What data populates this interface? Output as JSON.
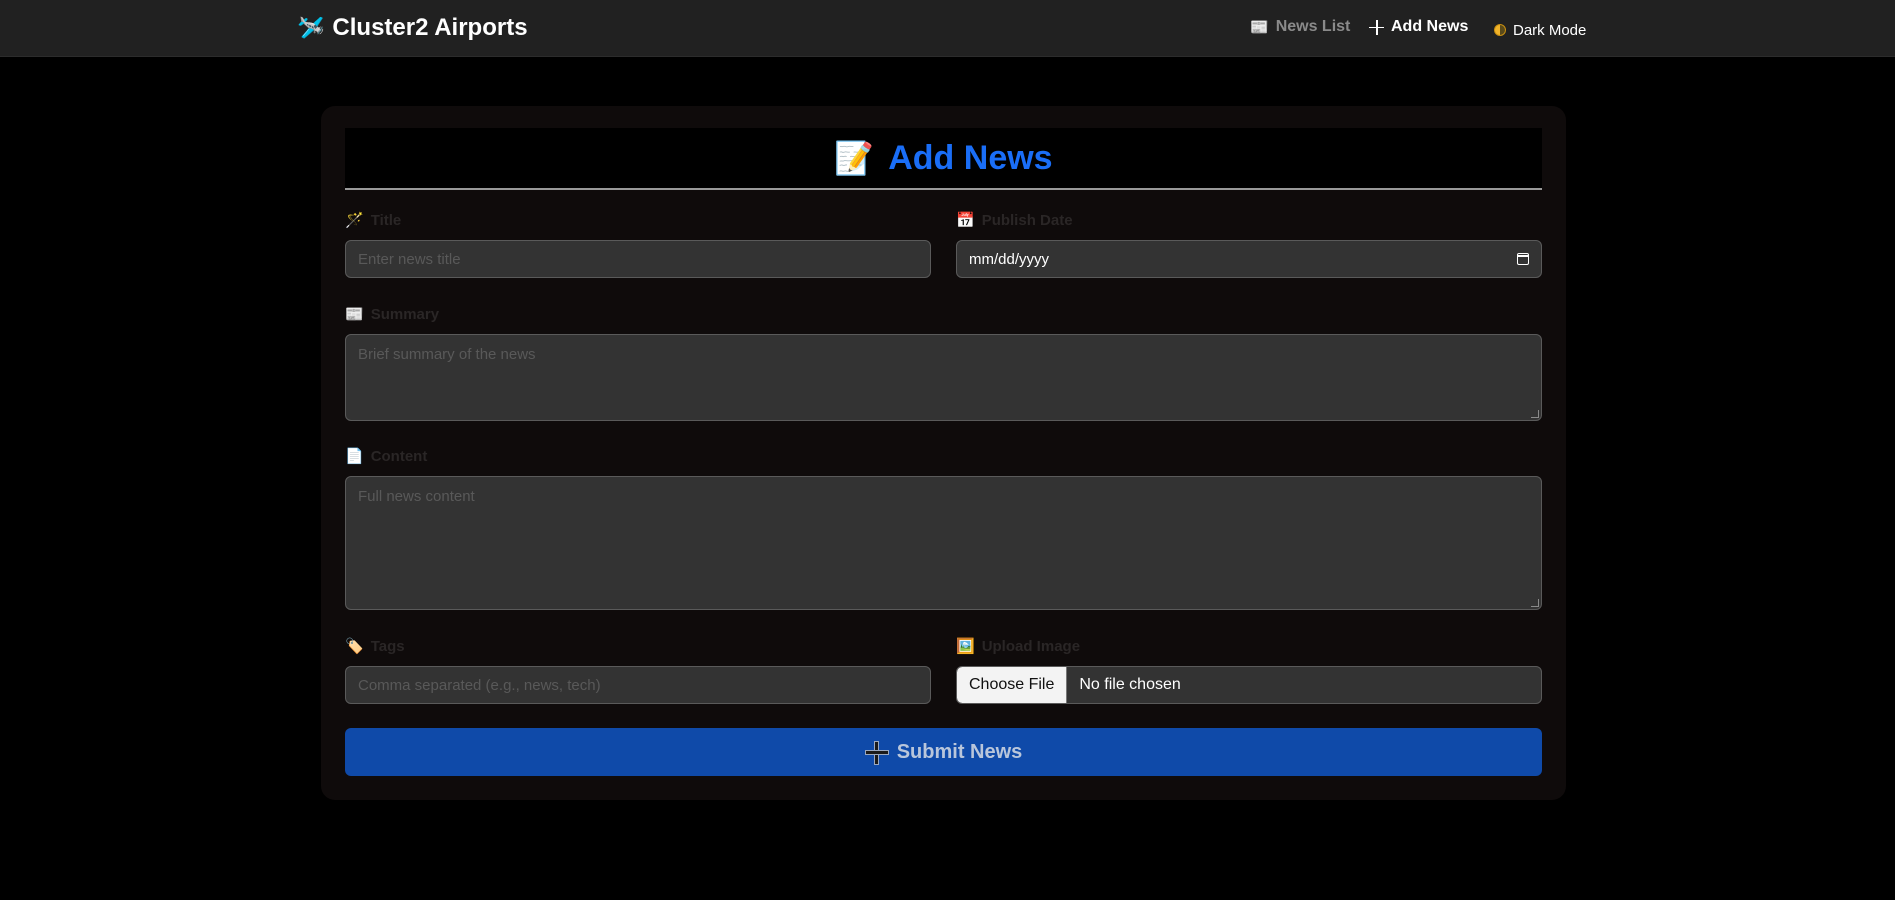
{
  "navbar": {
    "brand_icon": "🛩️",
    "brand": "Cluster2 Airports",
    "news_list_icon": "📰",
    "news_list": "News List",
    "add_news": "Add News",
    "dark_mode": "Dark Mode"
  },
  "form": {
    "header_icon": "📝",
    "header": "Add News",
    "title": {
      "icon": "🪄",
      "label": "Title",
      "placeholder": "Enter news title"
    },
    "publish_date": {
      "icon": "📅",
      "label": "Publish Date",
      "value": "mm/dd/yyyy"
    },
    "summary": {
      "icon": "📰",
      "label": "Summary",
      "placeholder": "Brief summary of the news"
    },
    "content": {
      "icon": "📄",
      "label": "Content",
      "placeholder": "Full news content"
    },
    "tags": {
      "icon": "🏷️",
      "label": "Tags",
      "placeholder": "Comma separated (e.g., news, tech)"
    },
    "upload_image": {
      "icon": "🖼️",
      "label": "Upload Image",
      "button": "Choose File",
      "status": "No file chosen"
    },
    "submit": "Submit News"
  },
  "colors": {
    "accent": "#1a6ef7",
    "submit_bg": "#0f4aa9",
    "navbar_bg": "#212121",
    "card_bg": "#0f0b0b",
    "input_bg": "#333333"
  }
}
